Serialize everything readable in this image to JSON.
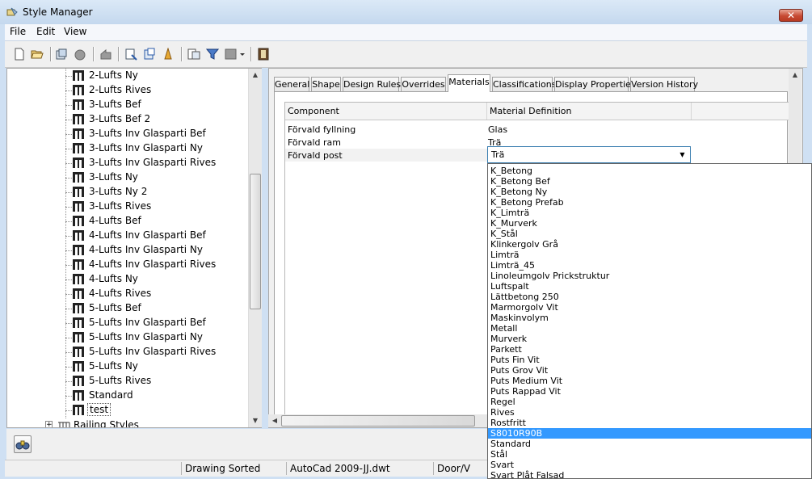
{
  "window": {
    "title": "Style Manager",
    "close_label": "✕"
  },
  "menu": {
    "items": [
      "File",
      "Edit",
      "View"
    ]
  },
  "toolbar": {
    "icons": [
      "new-icon",
      "open-icon",
      "copy-style-icon",
      "purge-icon",
      "sort-icon",
      "filter-icon",
      "properties-icon",
      "toggle-view-icon",
      "inventory-icon",
      "funnel-icon",
      "display-mode-icon",
      "dropdown-arrow-icon",
      "book-icon"
    ]
  },
  "tree": {
    "items": [
      "2-Lufts Ny",
      "2-Lufts Rives",
      "3-Lufts Bef",
      "3-Lufts Bef 2",
      "3-Lufts Inv Glasparti Bef",
      "3-Lufts Inv Glasparti Ny",
      "3-Lufts Inv Glasparti Rives",
      "3-Lufts Ny",
      "3-Lufts Ny 2",
      "3-Lufts Rives",
      "4-Lufts Bef",
      "4-Lufts Inv Glasparti Bef",
      "4-Lufts Inv Glasparti Ny",
      "4-Lufts Inv Glasparti Rives",
      "4-Lufts Ny",
      "4-Lufts Rives",
      "5-Lufts Bef",
      "5-Lufts Inv Glasparti Bef",
      "5-Lufts Inv Glasparti Ny",
      "5-Lufts Inv Glasparti Rives",
      "5-Lufts Ny",
      "5-Lufts Rives",
      "Standard",
      "test"
    ],
    "selected": "test",
    "next_group": "Railing Styles",
    "expand_symbol": "+"
  },
  "tabs": [
    "General",
    "Shape",
    "Design Rules",
    "Overrides",
    "Materials",
    "Classifications",
    "Display Properties",
    "Version History"
  ],
  "active_tab": "Materials",
  "materials": {
    "headers": {
      "component": "Component",
      "definition": "Material Definition"
    },
    "rows": [
      {
        "component": "Förvald fyllning",
        "definition": "Glas"
      },
      {
        "component": "Förvald ram",
        "definition": "Trä"
      },
      {
        "component": "Förvald post",
        "definition": ""
      }
    ],
    "combo_value": "Trä",
    "options": [
      "K_Betong",
      "K_Betong Bef",
      "K_Betong Ny",
      "K_Betong Prefab",
      "K_Limträ",
      "K_Murverk",
      "K_Stål",
      "Klinkergolv Grå",
      "Limträ",
      "Limträ_45",
      "Linoleumgolv Prickstruktur",
      "Luftspalt",
      "Lättbetong 250",
      "Marmorgolv Vit",
      "Maskinvolym",
      "Metall",
      "Murverk",
      "Parkett",
      "Puts Fin Vit",
      "Puts Grov Vit",
      "Puts Medium Vit",
      "Puts Rappad Vit",
      "Regel",
      "Rives",
      "Rostfritt",
      "S8010R90B",
      "Standard",
      "Stål",
      "Svart",
      "Svart Plåt Falsad"
    ],
    "selected_option": "S8010R90B"
  },
  "status": {
    "cells": [
      "",
      "Drawing Sorted",
      "AutoCad 2009-JJ.dwt",
      "Door/V"
    ]
  },
  "colors": {
    "selection": "#3399ff",
    "close_red": "#c74a33",
    "titlebar": "#cfe0f3"
  }
}
